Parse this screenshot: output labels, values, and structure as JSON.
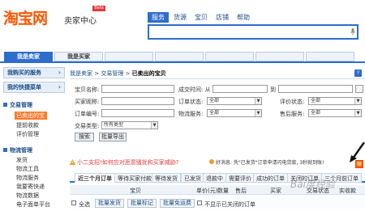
{
  "header": {
    "logo": "淘宝网",
    "logo_sub": "卖家中心",
    "beta": "Beta",
    "search_tabs": [
      "服务",
      "货源",
      "宝贝",
      "店铺",
      "帮助"
    ],
    "search_placeholder": ""
  },
  "nav": {
    "tabs": [
      "我是卖家",
      "我是买家",
      "",
      "",
      "",
      "",
      ""
    ]
  },
  "sidebar": {
    "heads": [
      "我购买的服务",
      "我的快捷菜单"
    ],
    "sections": [
      {
        "title": "交易管理",
        "items": [
          "已卖出的宝贝",
          "提前收款",
          "评价管理"
        ]
      },
      {
        "title": "物流管理",
        "items": [
          "发货",
          "物流工具",
          "物流服务",
          "我要寄快递",
          "物流数据",
          "电子面单平台"
        ]
      }
    ]
  },
  "breadcrumb": {
    "parts": [
      "我是卖家",
      "交易管理"
    ],
    "current": "已卖出的宝贝"
  },
  "filters": {
    "item_name_label": "宝贝名称:",
    "created_label": "成交时间: 从",
    "to_label": "到",
    "buyer_label": "买家昵称:",
    "order_status_label": "订单状态:",
    "order_status_value": "全部",
    "review_status_label": "评价状态:",
    "review_status_value": "全部",
    "order_no_label": "订单编号:",
    "logistics_label": "物流服务:",
    "logistics_value": "全部",
    "aftersale_label": "售后服务:",
    "aftersale_value": "全部",
    "type_label": "交易类型:",
    "type_value": "所有类型",
    "search_btn": "搜索",
    "export_btn": "批量导出"
  },
  "notice": {
    "left": "小二支招!如何应对恶意骚扰和买家威胁?",
    "right": "好消息: 凭\"已发货\"订单申请闪电贷款, 3秒就到账!"
  },
  "order_tabs": [
    "近三个月订单",
    "等待买家付款",
    "等待发货",
    "已发货",
    "退款中",
    "需要评价",
    "成功的订单",
    "关闭的订单",
    "三个月前订单"
  ],
  "table": {
    "headers": [
      "宝贝",
      "单价(元)",
      "数量",
      "售后",
      "买家",
      "交易状态",
      "实收款"
    ],
    "footer": {
      "select_all": "全选",
      "batch_ship": "批量发货",
      "batch_mark": "批量标记",
      "batch_free": "批量免运费",
      "hide_closed": "不显示已关闭的订单"
    }
  },
  "watermark": "Bai度经验",
  "colors": {
    "brand": "#ff5500",
    "primary": "#2d6dcb",
    "active_sidebar": "#ff7a2a"
  }
}
